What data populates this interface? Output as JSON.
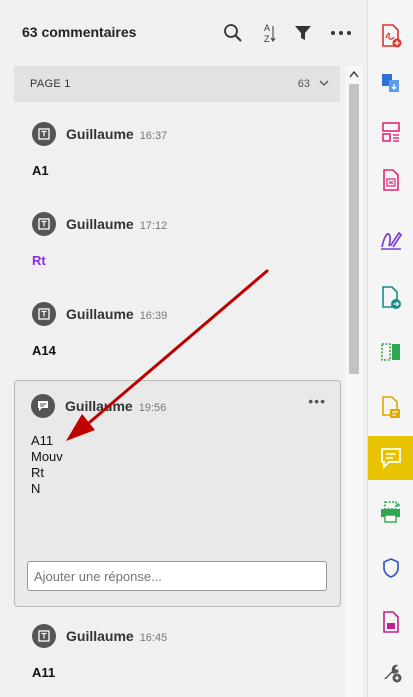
{
  "header": {
    "title": "63 commentaires",
    "icons": [
      "search-icon",
      "sort-az-icon",
      "filter-icon",
      "more-icon"
    ]
  },
  "page_bar": {
    "label": "PAGE 1",
    "count": "63"
  },
  "comments": [
    {
      "author": "Guillaume",
      "time": "16:37",
      "text": "A1"
    },
    {
      "author": "Guillaume",
      "time": "17:12",
      "text": "Rt"
    },
    {
      "author": "Guillaume",
      "time": "16:39",
      "text": "A14"
    },
    {
      "author": "Guillaume",
      "time": "19:56",
      "lines": [
        "A11",
        "Mouv",
        "Rt",
        "N"
      ]
    },
    {
      "author": "Guillaume",
      "time": "16:45",
      "text": "A11"
    }
  ],
  "reply": {
    "placeholder": "Ajouter une réponse..."
  },
  "colors": {
    "accent": "#e8c300",
    "purple_text": "#8a2be2",
    "arrow": "#c00000"
  },
  "rail_tools": [
    "create-pdf-icon",
    "export-pdf-icon",
    "organize-pages-icon",
    "compress-icon",
    "fill-sign-icon",
    "share-icon",
    "compare-icon",
    "edit-pdf-icon",
    "comment-icon",
    "print-production-icon",
    "protect-icon",
    "stamp-icon",
    "more-tools-icon"
  ]
}
